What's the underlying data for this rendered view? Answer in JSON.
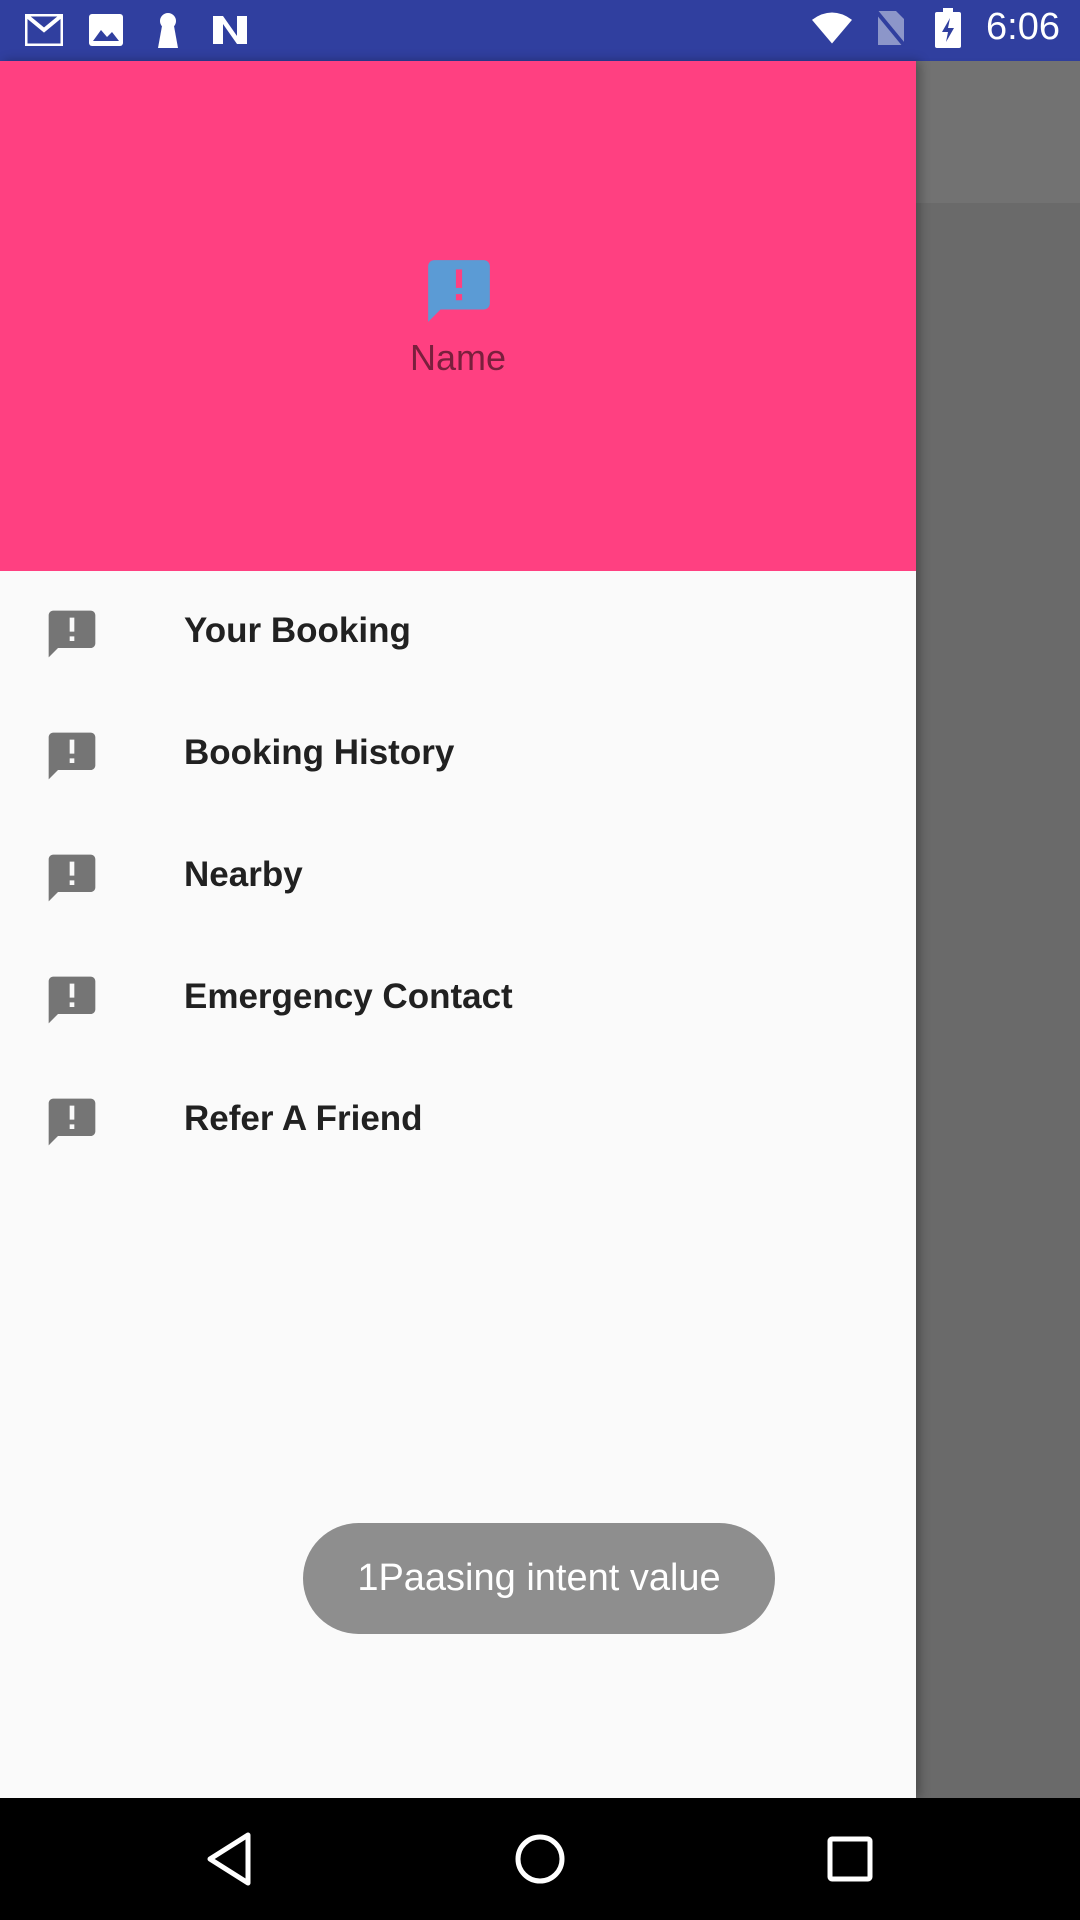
{
  "status_bar": {
    "time": "6:06",
    "left_icons": [
      "gmail-icon",
      "gallery-icon",
      "keyhole-icon",
      "n-icon"
    ],
    "right_icons": [
      "wifi-icon",
      "no-sim-icon",
      "battery-charging-icon"
    ],
    "background": "#303f9f"
  },
  "drawer": {
    "header": {
      "name": "Name",
      "icon": "feedback-icon",
      "background": "#ff4081"
    },
    "items": [
      {
        "label": "Your Booking",
        "icon": "feedback-icon"
      },
      {
        "label": "Booking History",
        "icon": "feedback-icon"
      },
      {
        "label": "Nearby",
        "icon": "feedback-icon"
      },
      {
        "label": "Emergency Contact",
        "icon": "feedback-icon"
      },
      {
        "label": "Refer A Friend",
        "icon": "feedback-icon"
      }
    ]
  },
  "toast": {
    "message": "1Paasing intent value"
  },
  "nav_bar": {
    "buttons": [
      "back-icon",
      "home-icon",
      "recents-icon"
    ]
  }
}
